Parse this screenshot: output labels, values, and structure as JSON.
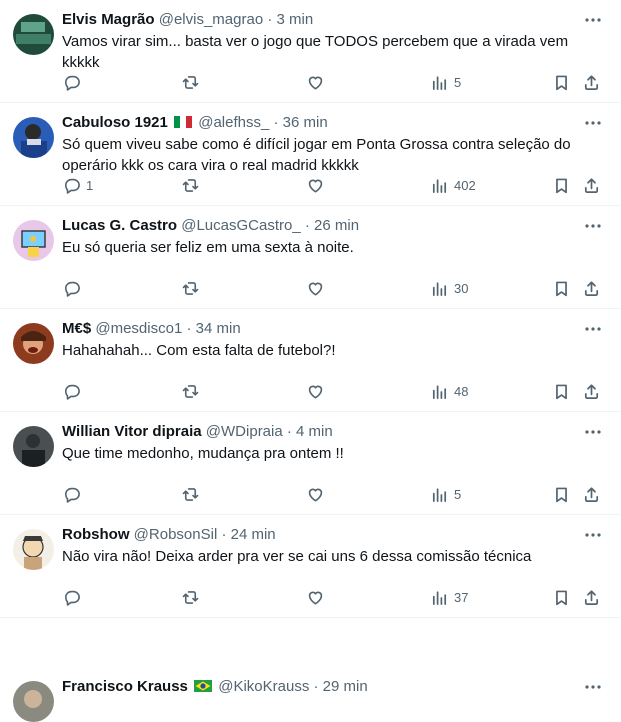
{
  "tweets": [
    {
      "name": "Elvis Magrão",
      "handle": "@elvis_magrao",
      "time": "3 min",
      "text": "Vamos virar sim... basta ver o jogo que TODOS percebem que a virada vem kkkkk",
      "replies": "",
      "views": "5",
      "flag": ""
    },
    {
      "name": "Cabuloso 1921",
      "handle": "@alefhss_",
      "time": "36 min",
      "text": "Só quem viveu sabe como é difícil jogar em Ponta Grossa contra seleção do operário kkk os cara vira o real madrid kkkkk",
      "replies": "1",
      "views": "402",
      "flag": "italy"
    },
    {
      "name": "Lucas G. Castro",
      "handle": "@LucasGCastro_",
      "time": "26 min",
      "text": "Eu só queria ser feliz em uma sexta à noite.",
      "replies": "",
      "views": "30",
      "flag": ""
    },
    {
      "name": "M€$",
      "handle": "@mesdisco1",
      "time": "34 min",
      "text": "Hahahahah... Com esta falta de futebol?!",
      "replies": "",
      "views": "48",
      "flag": ""
    },
    {
      "name": "Willian Vitor dipraia",
      "handle": "@WDipraia",
      "time": "4 min",
      "text": "Que time medonho, mudança pra ontem !!",
      "replies": "",
      "views": "5",
      "flag": ""
    },
    {
      "name": "Robshow",
      "handle": "@RobsonSil",
      "time": "24 min",
      "text": "Não vira não! Deixa arder pra ver se cai uns 6 dessa comissão técnica",
      "replies": "",
      "views": "37",
      "flag": ""
    }
  ],
  "partial_tweet": {
    "name": "Francisco Krauss",
    "handle": "@KikoKrauss",
    "time": "29 min",
    "flag": "brazil"
  },
  "separator": "·",
  "colors": {
    "text": "#0f1419",
    "muted": "#536471",
    "border": "#eff3f4"
  },
  "icons": [
    "more-icon",
    "reply-icon",
    "retweet-icon",
    "like-icon",
    "views-icon",
    "bookmark-icon",
    "share-icon"
  ]
}
